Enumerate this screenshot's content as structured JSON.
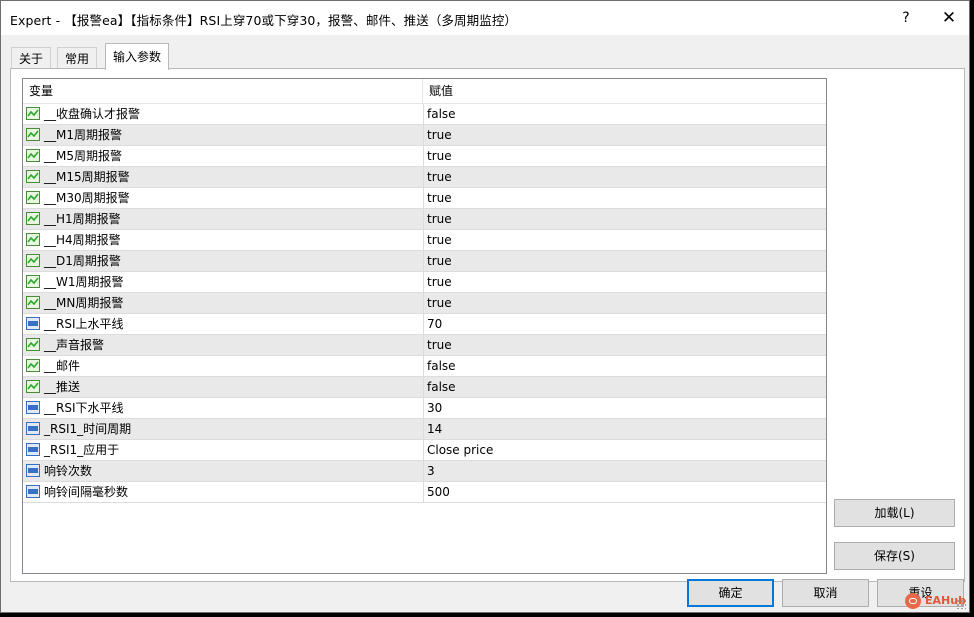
{
  "window": {
    "title": "Expert - 【报警ea】【指标条件】RSI上穿70或下穿30，报警、邮件、推送（多周期监控）",
    "help_label": "?",
    "close_label": "✕"
  },
  "tabs": [
    {
      "label": "关于"
    },
    {
      "label": "常用"
    },
    {
      "label": "输入参数"
    }
  ],
  "table": {
    "headers": {
      "variable": "变量",
      "value": "赋值"
    },
    "rows": [
      {
        "name": "__收盘确认才报警",
        "value": "false",
        "icon": "bool-icon"
      },
      {
        "name": "__M1周期报警",
        "value": "true",
        "icon": "bool-icon"
      },
      {
        "name": "__M5周期报警",
        "value": "true",
        "icon": "bool-icon"
      },
      {
        "name": "__M15周期报警",
        "value": "true",
        "icon": "bool-icon"
      },
      {
        "name": "__M30周期报警",
        "value": "true",
        "icon": "bool-icon"
      },
      {
        "name": "__H1周期报警",
        "value": "true",
        "icon": "bool-icon"
      },
      {
        "name": "__H4周期报警",
        "value": "true",
        "icon": "bool-icon"
      },
      {
        "name": "__D1周期报警",
        "value": "true",
        "icon": "bool-icon"
      },
      {
        "name": "__W1周期报警",
        "value": "true",
        "icon": "bool-icon"
      },
      {
        "name": "__MN周期报警",
        "value": "true",
        "icon": "bool-icon"
      },
      {
        "name": "__RSI上水平线",
        "value": "70",
        "icon": "number-icon"
      },
      {
        "name": "__声音报警",
        "value": "true",
        "icon": "bool-icon"
      },
      {
        "name": "__邮件",
        "value": "false",
        "icon": "bool-icon"
      },
      {
        "name": "__推送",
        "value": "false",
        "icon": "bool-icon"
      },
      {
        "name": "__RSI下水平线",
        "value": "30",
        "icon": "number-icon"
      },
      {
        "name": "_RSI1_时间周期",
        "value": "14",
        "icon": "number-icon"
      },
      {
        "name": "_RSI1_应用于",
        "value": "Close price",
        "icon": "number-icon"
      },
      {
        "name": "响铃次数",
        "value": "3",
        "icon": "number-icon"
      },
      {
        "name": "响铃间隔毫秒数",
        "value": "500",
        "icon": "number-icon"
      }
    ]
  },
  "buttons": {
    "load": "加载(L)",
    "save": "保存(S)",
    "ok": "确定",
    "cancel": "取消",
    "reset": "重设"
  },
  "watermark": {
    "text": "EAHub"
  },
  "colors": {
    "accent": "#0078d7",
    "alt_row": "#e9e9e9",
    "bool_icon": "#2eaa2e",
    "number_icon": "#3a6fc4"
  }
}
